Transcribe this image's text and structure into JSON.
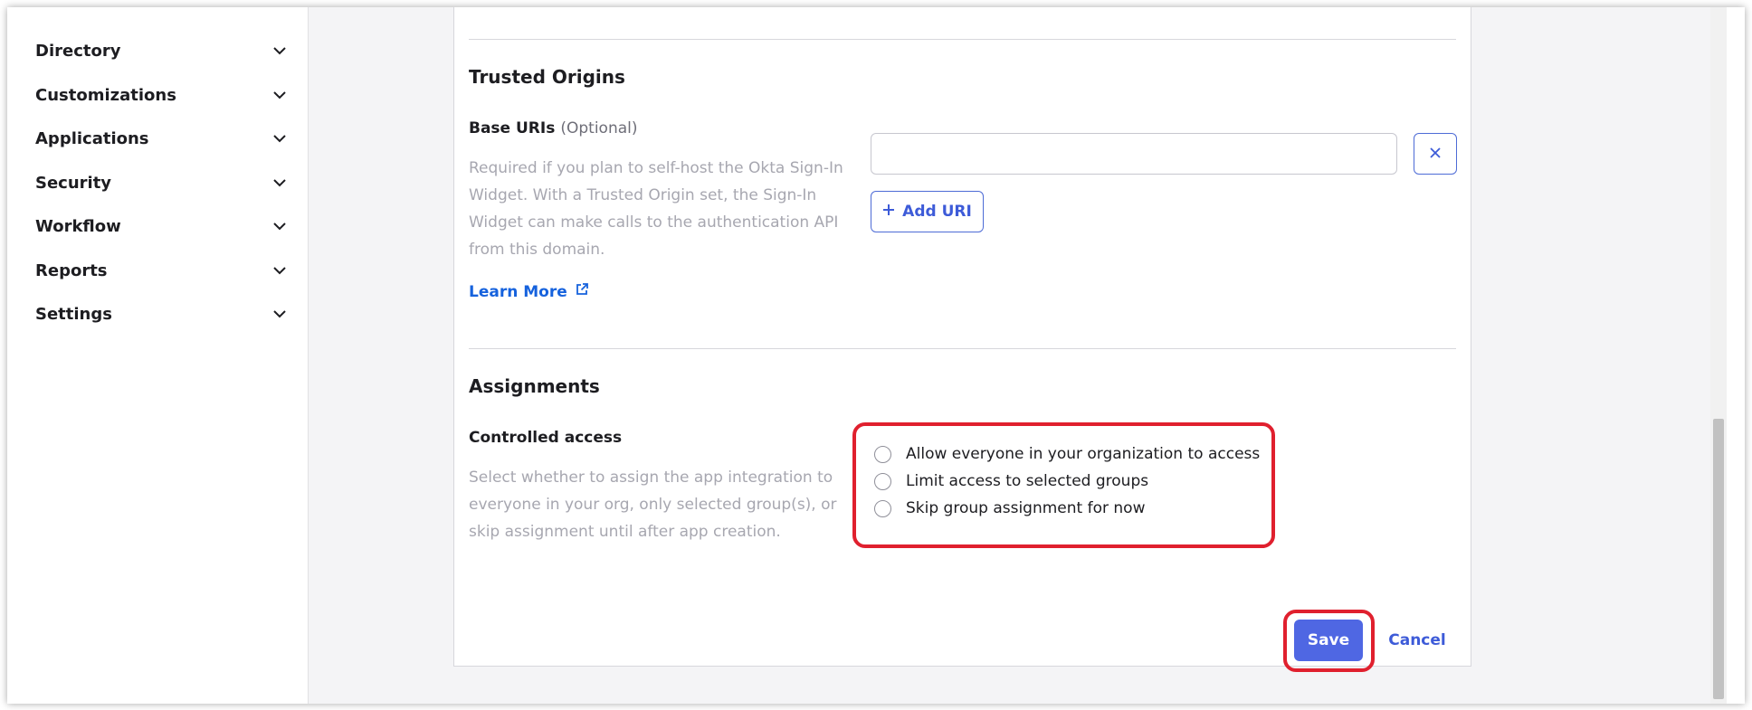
{
  "sidebar": {
    "items": [
      {
        "label": "Directory"
      },
      {
        "label": "Customizations"
      },
      {
        "label": "Applications"
      },
      {
        "label": "Security"
      },
      {
        "label": "Workflow"
      },
      {
        "label": "Reports"
      },
      {
        "label": "Settings"
      }
    ]
  },
  "trusted_origins": {
    "title": "Trusted Origins",
    "base_uris": {
      "label": "Base URIs",
      "optional": "(Optional)",
      "value": "",
      "help_lines": [
        "Required if you plan to self-host the Okta Sign-In",
        "Widget. With a Trusted Origin set, the Sign-In",
        "Widget can make calls to the authentication API",
        "from this domain."
      ],
      "learn_more": "Learn More",
      "add_uri": "Add URI",
      "remove_icon": "close-icon"
    }
  },
  "assignments": {
    "title": "Assignments",
    "controlled_access": {
      "label": "Controlled access",
      "help_lines": [
        "Select whether to assign the app integration to",
        "everyone in your org, only selected group(s), or",
        "skip assignment until after app creation."
      ],
      "options": [
        {
          "label": "Allow everyone in your organization to access",
          "selected": false
        },
        {
          "label": "Limit access to selected groups",
          "selected": false
        },
        {
          "label": "Skip group assignment for now",
          "selected": false
        }
      ]
    }
  },
  "actions": {
    "save": "Save",
    "cancel": "Cancel"
  },
  "colors": {
    "primary": "#4f67e3",
    "link": "#1662dd",
    "highlight": "#e0202e"
  }
}
